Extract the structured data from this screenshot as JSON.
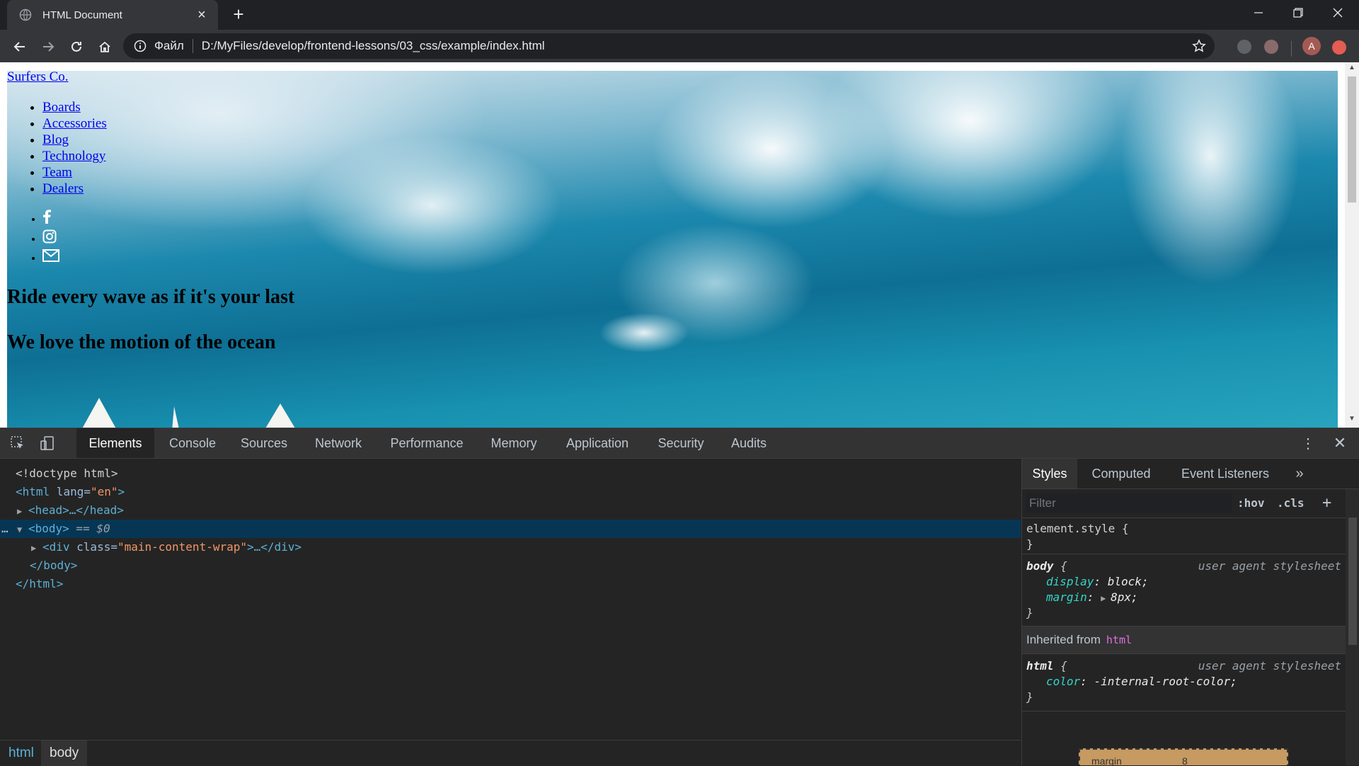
{
  "browser": {
    "tab_title": "HTML Document",
    "scheme_label": "Файл",
    "url": "D:/MyFiles/develop/frontend-lessons/03_css/example/index.html",
    "avatar_letter": "A"
  },
  "page": {
    "logo": "Surfers Co.",
    "nav": [
      "Boards",
      "Accessories",
      "Blog",
      "Technology",
      "Team",
      "Dealers"
    ],
    "social_icons": [
      "facebook-icon",
      "instagram-icon",
      "mail-icon"
    ],
    "headline": "Ride every wave as if it's your last",
    "subheadline": "We love the motion of the ocean"
  },
  "devtools": {
    "tabs": [
      "Elements",
      "Console",
      "Sources",
      "Network",
      "Performance",
      "Memory",
      "Application",
      "Security",
      "Audits"
    ],
    "active_tab": "Elements",
    "dom": {
      "doctype": "<!doctype html>",
      "html_open_tag": "<html",
      "html_lang_attr": " lang=",
      "html_lang_val": "\"en\"",
      "html_open_close": ">",
      "head": "<head>…</head>",
      "body_open": "<body>",
      "body_marker": " == $0",
      "div_open": "<div",
      "div_class_attr": " class=",
      "div_class_val": "\"main-content-wrap\"",
      "div_rest": ">…</div>",
      "body_close": "</body>",
      "html_close": "</html>",
      "dots": "…"
    },
    "breadcrumbs": [
      "html",
      "body"
    ],
    "sidebar": {
      "tabs": [
        "Styles",
        "Computed",
        "Event Listeners"
      ],
      "filter_placeholder": "Filter",
      "hov": ":hov",
      "cls": ".cls",
      "add": "+",
      "element_style_selector": "element.style",
      "body_selector": "body",
      "ua_label": "user agent stylesheet",
      "body_props": [
        {
          "name": "display",
          "value": "block;"
        },
        {
          "name": "margin",
          "value": "8px;"
        }
      ],
      "inherited_label": "Inherited from",
      "inherited_tag": "html",
      "html_selector": "html",
      "html_props": [
        {
          "name": "color",
          "value": "-internal-root-color;"
        }
      ],
      "box_model_label": "margin",
      "box_model_value": "8"
    }
  },
  "colors": {
    "link": "#0000ee",
    "selection": "#073655",
    "tag": "#5db0d7",
    "attr_value": "#f29766",
    "prop_name": "#35d4c7"
  }
}
